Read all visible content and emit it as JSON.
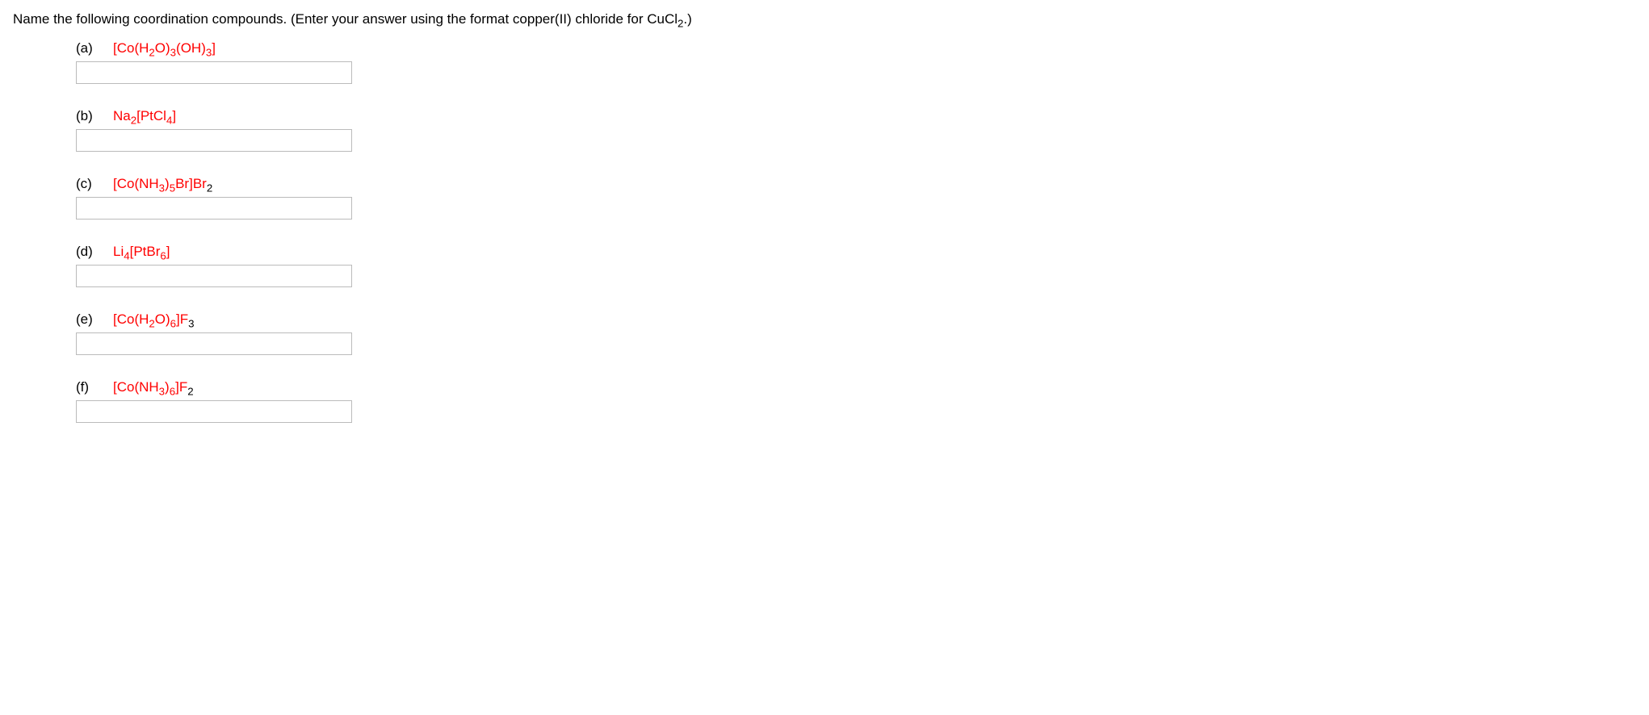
{
  "instruction_prefix": "Name the following coordination compounds. (Enter your answer using the format copper(II) chloride for CuCl",
  "instruction_sub": "2",
  "instruction_suffix": ".)",
  "items": [
    {
      "letter": "(a)",
      "parts": [
        {
          "t": "[Co(H"
        },
        {
          "sub": "2"
        },
        {
          "t": "O)"
        },
        {
          "sub": "3"
        },
        {
          "t": "(OH)"
        },
        {
          "sub": "3"
        },
        {
          "t": "]"
        }
      ]
    },
    {
      "letter": "(b)",
      "parts": [
        {
          "t": "Na"
        },
        {
          "sub": "2"
        },
        {
          "t": "[PtCl"
        },
        {
          "sub": "4"
        },
        {
          "t": "]"
        }
      ]
    },
    {
      "letter": "(c)",
      "parts": [
        {
          "t": "[Co(NH"
        },
        {
          "sub": "3"
        },
        {
          "t": ")"
        },
        {
          "sub": "5"
        },
        {
          "t": "Br]Br"
        },
        {
          "sub": "2",
          "black": true
        }
      ]
    },
    {
      "letter": "(d)",
      "parts": [
        {
          "t": "Li"
        },
        {
          "sub": "4"
        },
        {
          "t": "[PtBr"
        },
        {
          "sub": "6"
        },
        {
          "t": "]"
        }
      ]
    },
    {
      "letter": "(e)",
      "parts": [
        {
          "t": "[Co(H"
        },
        {
          "sub": "2"
        },
        {
          "t": "O)"
        },
        {
          "sub": "6"
        },
        {
          "t": "]F"
        },
        {
          "sub": "3",
          "black": true
        }
      ]
    },
    {
      "letter": "(f)",
      "parts": [
        {
          "t": "[Co(NH"
        },
        {
          "sub": "3"
        },
        {
          "t": ")"
        },
        {
          "sub": "6"
        },
        {
          "t": "]F"
        },
        {
          "sub": "2",
          "black": true
        }
      ]
    }
  ]
}
